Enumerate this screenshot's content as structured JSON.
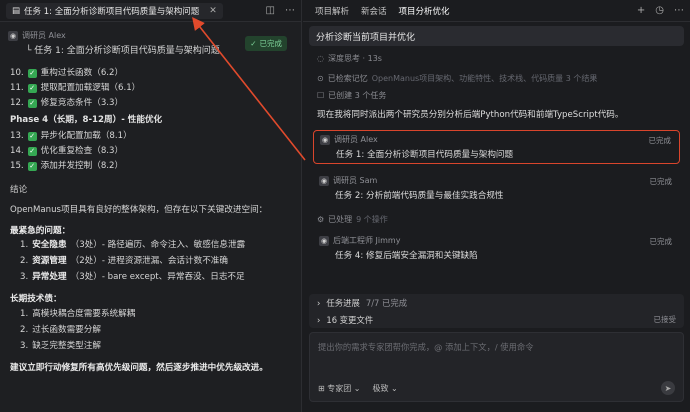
{
  "left": {
    "tab_title": "任务 1: 全面分析诊断项目代码质量与架构问题",
    "agent_name": "调研员 Alex",
    "agent_task": "任务 1: 全面分析诊断项目代码质量与架构问题",
    "done_badge": "已完成",
    "checklist_a": [
      {
        "num": "10.",
        "text": "重构过长函数（6.2）"
      },
      {
        "num": "11.",
        "text": "提取配置加载逻辑（6.1）"
      },
      {
        "num": "12.",
        "text": "修复竞态条件（3.3）"
      }
    ],
    "phase4": "Phase 4（长期，8-12周）- 性能优化",
    "checklist_b": [
      {
        "num": "13.",
        "text": "异步化配置加载（8.1）"
      },
      {
        "num": "14.",
        "text": "优化重复检查（8.3）"
      },
      {
        "num": "15.",
        "text": "添加并发控制（8.2）"
      }
    ],
    "conclusion_title": "结论",
    "conclusion_text": "OpenManus项目具有良好的整体架构，但存在以下关键改进空间：",
    "urgent_title": "最紧急的问题：",
    "urgent_items": [
      {
        "num": "1.",
        "bold": "安全隐患",
        "rest": "（3处）- 路径遍历、命令注入、敏感信息泄露"
      },
      {
        "num": "2.",
        "bold": "资源管理",
        "rest": "（2处）- 进程资源泄漏、会话计数不准确"
      },
      {
        "num": "3.",
        "bold": "异常处理",
        "rest": "（3处）- bare except、异常吞没、日志不足"
      }
    ],
    "debt_title": "长期技术债：",
    "debt_items": [
      {
        "num": "1.",
        "text": "高模块耦合度需要系统解耦"
      },
      {
        "num": "2.",
        "text": "过长函数需要分解"
      },
      {
        "num": "3.",
        "text": "缺乏完整类型注解"
      }
    ],
    "final_advice": "建议立即行动修复所有高优先级问题，然后逐步推进中优先级改进。"
  },
  "right": {
    "tabs": [
      "项目解析",
      "新会话",
      "项目分析优化"
    ],
    "query": "分析诊断当前项目并优化",
    "thinking": "深度思考 · 13s",
    "memory_label": "已检索记忆",
    "memory_detail": "OpenManus项目架构、功能特性、技术栈、代码质量 3 个结果",
    "created_label": "已创建 3 个任务",
    "dispatch_text": "现在我将同时派出两个研究员分别分析后端Python代码和前端TypeScript代码。",
    "tasks": [
      {
        "agent": "调研员 Alex",
        "status": "已完成",
        "text": "任务 1: 全面分析诊断项目代码质量与架构问题"
      },
      {
        "agent": "调研员 Sam",
        "status": "已完成",
        "text": "任务 2: 分析前端代码质量与最佳实践合规性"
      }
    ],
    "processed_label": "已处理",
    "processed_detail": "9 个操作",
    "task4": {
      "agent": "后端工程师 Jimmy",
      "status": "已完成",
      "text": "任务 4: 修复后端安全漏洞和关键缺陷"
    },
    "progress_label": "任务进展",
    "progress_value": "7/7 已完成",
    "changes_label": "16 变更文件",
    "changes_status": "已接受",
    "composer_placeholder": "提出你的需求专家团帮你完成，@ 添加上下文，/ 使用命令",
    "team_label": "专家团",
    "mode_label": "极致"
  }
}
